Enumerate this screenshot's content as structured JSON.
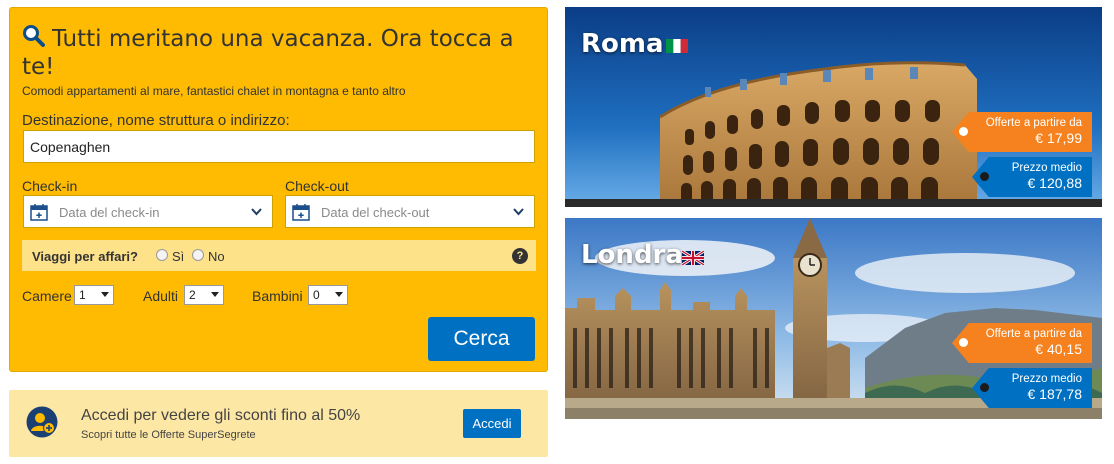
{
  "search": {
    "headline": "Tutti meritano una vacanza. Ora tocca a te!",
    "subline": "Comodi appartamenti al mare, fantastici chalet in montagna e tanto altro",
    "destination_label": "Destinazione, nome struttura o indirizzo:",
    "destination_value": "Copenaghen",
    "checkin_label": "Check-in",
    "checkin_placeholder": "Data del check-in",
    "checkout_label": "Check-out",
    "checkout_placeholder": "Data del check-out",
    "business_label": "Viaggi per affari?",
    "business_yes": "Sì",
    "business_no": "No",
    "help": "?",
    "rooms_label": "Camere",
    "rooms_value": "1",
    "adults_label": "Adulti",
    "adults_value": "2",
    "children_label": "Bambini",
    "children_value": "0",
    "submit_label": "Cerca"
  },
  "login": {
    "title": "Accedi per vedere gli sconti fino al 50%",
    "subtitle": "Scopri tutte le Offerte SuperSegrete",
    "button_label": "Accedi"
  },
  "destinations": [
    {
      "city": "Roma",
      "flag_icon": "italy-flag-icon",
      "offers_label": "Offerte a partire da",
      "offers_price": "€ 17,99",
      "avg_label": "Prezzo medio",
      "avg_price": "€ 120,88"
    },
    {
      "city": "Londra",
      "flag_icon": "uk-flag-icon",
      "offers_label": "Offerte a partire da",
      "offers_price": "€ 40,15",
      "avg_label": "Prezzo medio",
      "avg_price": "€ 187,78"
    }
  ],
  "colors": {
    "brand_yellow": "#febb02",
    "brand_blue": "#0071c2",
    "offer_orange": "#f5821f"
  }
}
